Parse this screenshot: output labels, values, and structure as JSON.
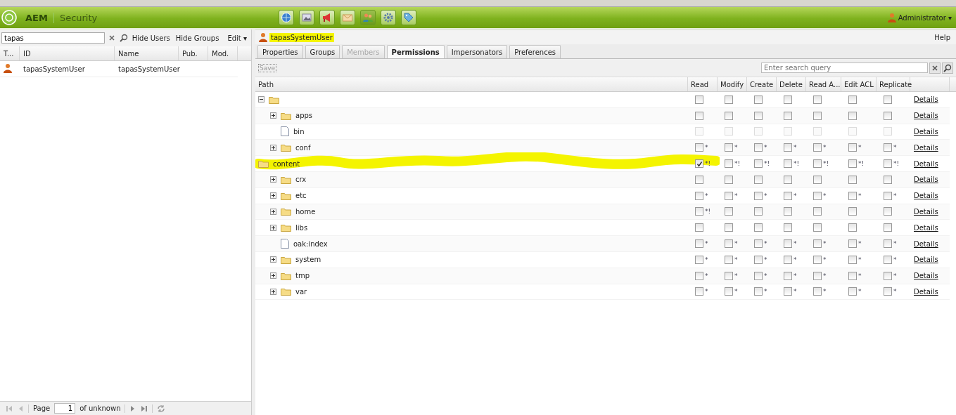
{
  "app": {
    "brand": "AEM",
    "section": "Security",
    "user_menu": "Administrator ▾"
  },
  "toolbar_icons": [
    {
      "kind": "globe",
      "selected": false
    },
    {
      "kind": "picture",
      "selected": false
    },
    {
      "kind": "megaphone",
      "selected": false
    },
    {
      "kind": "envelope",
      "selected": false
    },
    {
      "kind": "users",
      "selected": true
    },
    {
      "kind": "gear",
      "selected": false
    },
    {
      "kind": "tag",
      "selected": false
    }
  ],
  "left": {
    "search": {
      "value": "tapas"
    },
    "actions": [
      "Hide Users",
      "Hide Groups"
    ],
    "edit_menu": "Edit ▾",
    "columns": [
      "T...",
      "ID",
      "Name",
      "Pub.",
      "Mod."
    ],
    "rows": [
      {
        "id": "tapasSystemUser",
        "name": "tapasSystemUser"
      }
    ],
    "pager": {
      "page_label": "Page",
      "page": "1",
      "of": "of unknown"
    }
  },
  "right": {
    "user": {
      "name": "tapasSystemUser",
      "highlighted": true
    },
    "help": "Help",
    "tabs": [
      {
        "label": "Properties",
        "selected": false,
        "disabled": false
      },
      {
        "label": "Groups",
        "selected": false,
        "disabled": false
      },
      {
        "label": "Members",
        "selected": false,
        "disabled": true
      },
      {
        "label": "Permissions",
        "selected": true,
        "disabled": false
      },
      {
        "label": "Impersonators",
        "selected": false,
        "disabled": false
      },
      {
        "label": "Preferences",
        "selected": false,
        "disabled": false
      }
    ],
    "save": {
      "label": "Save",
      "disabled": true
    },
    "search": {
      "placeholder": "Enter search query"
    },
    "columns": [
      "Path",
      "Read",
      "Modify",
      "Create",
      "Delete",
      "Read A...",
      "Edit ACL",
      "Replicate"
    ],
    "tree": [
      {
        "kind": "folder",
        "expanded": true,
        "highlighted": false,
        "disabled": false,
        "perms": [
          {
            "checked": false
          },
          {
            "checked": false
          },
          {
            "checked": false
          },
          {
            "checked": false
          },
          {
            "checked": false
          },
          {
            "checked": false
          },
          {
            "checked": false
          }
        ],
        "details": "Details",
        "children": [
          {
            "name": "apps",
            "kind": "folder",
            "expanded": false,
            "highlighted": false,
            "disabled": false,
            "perms": [
              {
                "checked": false
              },
              {
                "checked": false
              },
              {
                "checked": false
              },
              {
                "checked": false
              },
              {
                "checked": false
              },
              {
                "checked": false
              },
              {
                "checked": false
              }
            ],
            "details": "Details"
          },
          {
            "name": "bin",
            "kind": "file",
            "highlighted": false,
            "disabled": true,
            "perms": [
              {
                "checked": false
              },
              {
                "checked": false
              },
              {
                "checked": false
              },
              {
                "checked": false
              },
              {
                "checked": false
              },
              {
                "checked": false
              },
              {
                "checked": false
              }
            ],
            "details": "Details"
          },
          {
            "name": "conf",
            "kind": "folder",
            "expanded": false,
            "highlighted": false,
            "disabled": false,
            "perms": [
              {
                "checked": false,
                "note": "*"
              },
              {
                "checked": false,
                "note": "*"
              },
              {
                "checked": false,
                "note": "*"
              },
              {
                "checked": false,
                "note": "*"
              },
              {
                "checked": false,
                "note": "*"
              },
              {
                "checked": false,
                "note": "*"
              },
              {
                "checked": false,
                "note": "*"
              }
            ],
            "details": "Details"
          }
        ]
      },
      {
        "name": "content",
        "kind": "folder",
        "highlighted": true,
        "disabled": false,
        "perms": [
          {
            "checked": true,
            "note": "*!"
          },
          {
            "checked": false,
            "note": "*!"
          },
          {
            "checked": false,
            "note": "*!"
          },
          {
            "checked": false,
            "note": "*!"
          },
          {
            "checked": false,
            "note": "*!"
          },
          {
            "checked": false,
            "note": "*!"
          },
          {
            "checked": false,
            "note": "*!"
          }
        ],
        "details": "Details",
        "children": [
          {
            "name": "crx",
            "kind": "folder",
            "expanded": false,
            "highlighted": false,
            "disabled": false,
            "perms": [
              {
                "checked": false
              },
              {
                "checked": false
              },
              {
                "checked": false
              },
              {
                "checked": false
              },
              {
                "checked": false
              },
              {
                "checked": false
              },
              {
                "checked": false
              }
            ],
            "details": "Details"
          },
          {
            "name": "etc",
            "kind": "folder",
            "expanded": false,
            "highlighted": false,
            "disabled": false,
            "perms": [
              {
                "checked": false,
                "note": "*"
              },
              {
                "checked": false,
                "note": "*"
              },
              {
                "checked": false,
                "note": "*"
              },
              {
                "checked": false,
                "note": "*"
              },
              {
                "checked": false,
                "note": "*"
              },
              {
                "checked": false,
                "note": "*"
              },
              {
                "checked": false,
                "note": "*"
              }
            ],
            "details": "Details"
          },
          {
            "name": "home",
            "kind": "folder",
            "expanded": false,
            "highlighted": false,
            "disabled": false,
            "perms": [
              {
                "checked": false,
                "note": "*!"
              },
              {
                "checked": false
              },
              {
                "checked": false
              },
              {
                "checked": false
              },
              {
                "checked": false
              },
              {
                "checked": false
              },
              {
                "checked": false
              }
            ],
            "details": "Details"
          },
          {
            "name": "libs",
            "kind": "folder",
            "expanded": false,
            "highlighted": false,
            "disabled": false,
            "perms": [
              {
                "checked": false
              },
              {
                "checked": false
              },
              {
                "checked": false
              },
              {
                "checked": false
              },
              {
                "checked": false
              },
              {
                "checked": false
              },
              {
                "checked": false
              }
            ],
            "details": "Details"
          },
          {
            "name": "oak:index",
            "kind": "file",
            "highlighted": false,
            "disabled": false,
            "perms": [
              {
                "checked": false,
                "note": "*"
              },
              {
                "checked": false,
                "note": "*"
              },
              {
                "checked": false,
                "note": "*"
              },
              {
                "checked": false,
                "note": "*"
              },
              {
                "checked": false,
                "note": "*"
              },
              {
                "checked": false,
                "note": "*"
              },
              {
                "checked": false,
                "note": "*"
              }
            ],
            "details": "Details"
          },
          {
            "name": "system",
            "kind": "folder",
            "expanded": false,
            "highlighted": false,
            "disabled": false,
            "perms": [
              {
                "checked": false,
                "note": "*"
              },
              {
                "checked": false,
                "note": "*"
              },
              {
                "checked": false,
                "note": "*"
              },
              {
                "checked": false,
                "note": "*"
              },
              {
                "checked": false,
                "note": "*"
              },
              {
                "checked": false,
                "note": "*"
              },
              {
                "checked": false,
                "note": "*"
              }
            ],
            "details": "Details"
          },
          {
            "name": "tmp",
            "kind": "folder",
            "expanded": false,
            "highlighted": false,
            "disabled": false,
            "perms": [
              {
                "checked": false,
                "note": "*"
              },
              {
                "checked": false,
                "note": "*"
              },
              {
                "checked": false,
                "note": "*"
              },
              {
                "checked": false,
                "note": "*"
              },
              {
                "checked": false,
                "note": "*"
              },
              {
                "checked": false,
                "note": "*"
              },
              {
                "checked": false,
                "note": "*"
              }
            ],
            "details": "Details"
          },
          {
            "name": "var",
            "kind": "folder",
            "expanded": false,
            "highlighted": false,
            "disabled": false,
            "perms": [
              {
                "checked": false,
                "note": "*"
              },
              {
                "checked": false,
                "note": "*"
              },
              {
                "checked": false,
                "note": "*"
              },
              {
                "checked": false,
                "note": "*"
              },
              {
                "checked": false,
                "note": "*"
              },
              {
                "checked": false,
                "note": "*"
              },
              {
                "checked": false,
                "note": "*"
              }
            ],
            "details": "Details"
          }
        ]
      }
    ]
  }
}
